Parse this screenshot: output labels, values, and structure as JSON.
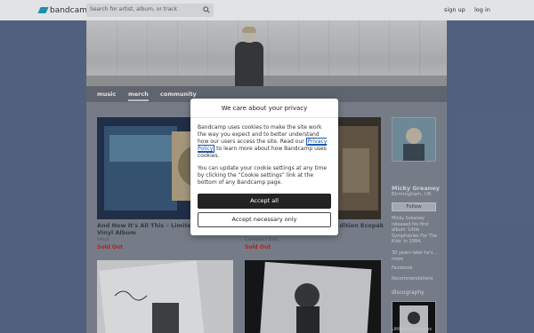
{
  "topbar": {
    "logo_text": "bandcamp",
    "search_placeholder": "Search for artist, album, or track",
    "signup": "sign up",
    "login": "log in"
  },
  "nav": {
    "tabs": [
      "music",
      "merch",
      "community"
    ],
    "active": "merch"
  },
  "items": [
    {
      "title": "And Now It's All This – Limited Edition Vinyl Album",
      "subtitle": "Vinyl",
      "status": "Sold Out"
    },
    {
      "title": "Edition Ecopak",
      "subtitle": "Compact Disc",
      "status": "Sold Out"
    }
  ],
  "sidebar": {
    "artist_name": "Micky Greaney",
    "location": "Birmingham, UK",
    "follow_label": "Follow",
    "bio": "Micky Greaney released his first album 'Little Symphonies For The Kids' in 1994.",
    "bio_more": "30 years later he's ... more",
    "facebook": "Facebook",
    "recommendations": "Recommendations",
    "discography_heading": "discography",
    "disc_title": "Little Symphonies"
  },
  "modal": {
    "title": "We care about your privacy",
    "body_part1": "Bandcamp uses cookies to make the site work the way you expect and to better understand how our users access the site. Read our ",
    "privacy_link": "Privacy Policy",
    "body_part2": " to learn more about how Bandcamp uses cookies.",
    "body_para2": "You can update your cookie settings at any time by clicking the “Cookie settings” link at the bottom of any Bandcamp page.",
    "accept_all": "Accept all",
    "accept_necessary": "Accept necessary only"
  },
  "colors": {
    "background": "#5c6a8c",
    "brand": "#1da0c3",
    "sold_out": "#cc2222",
    "accept_button": "#242424"
  }
}
